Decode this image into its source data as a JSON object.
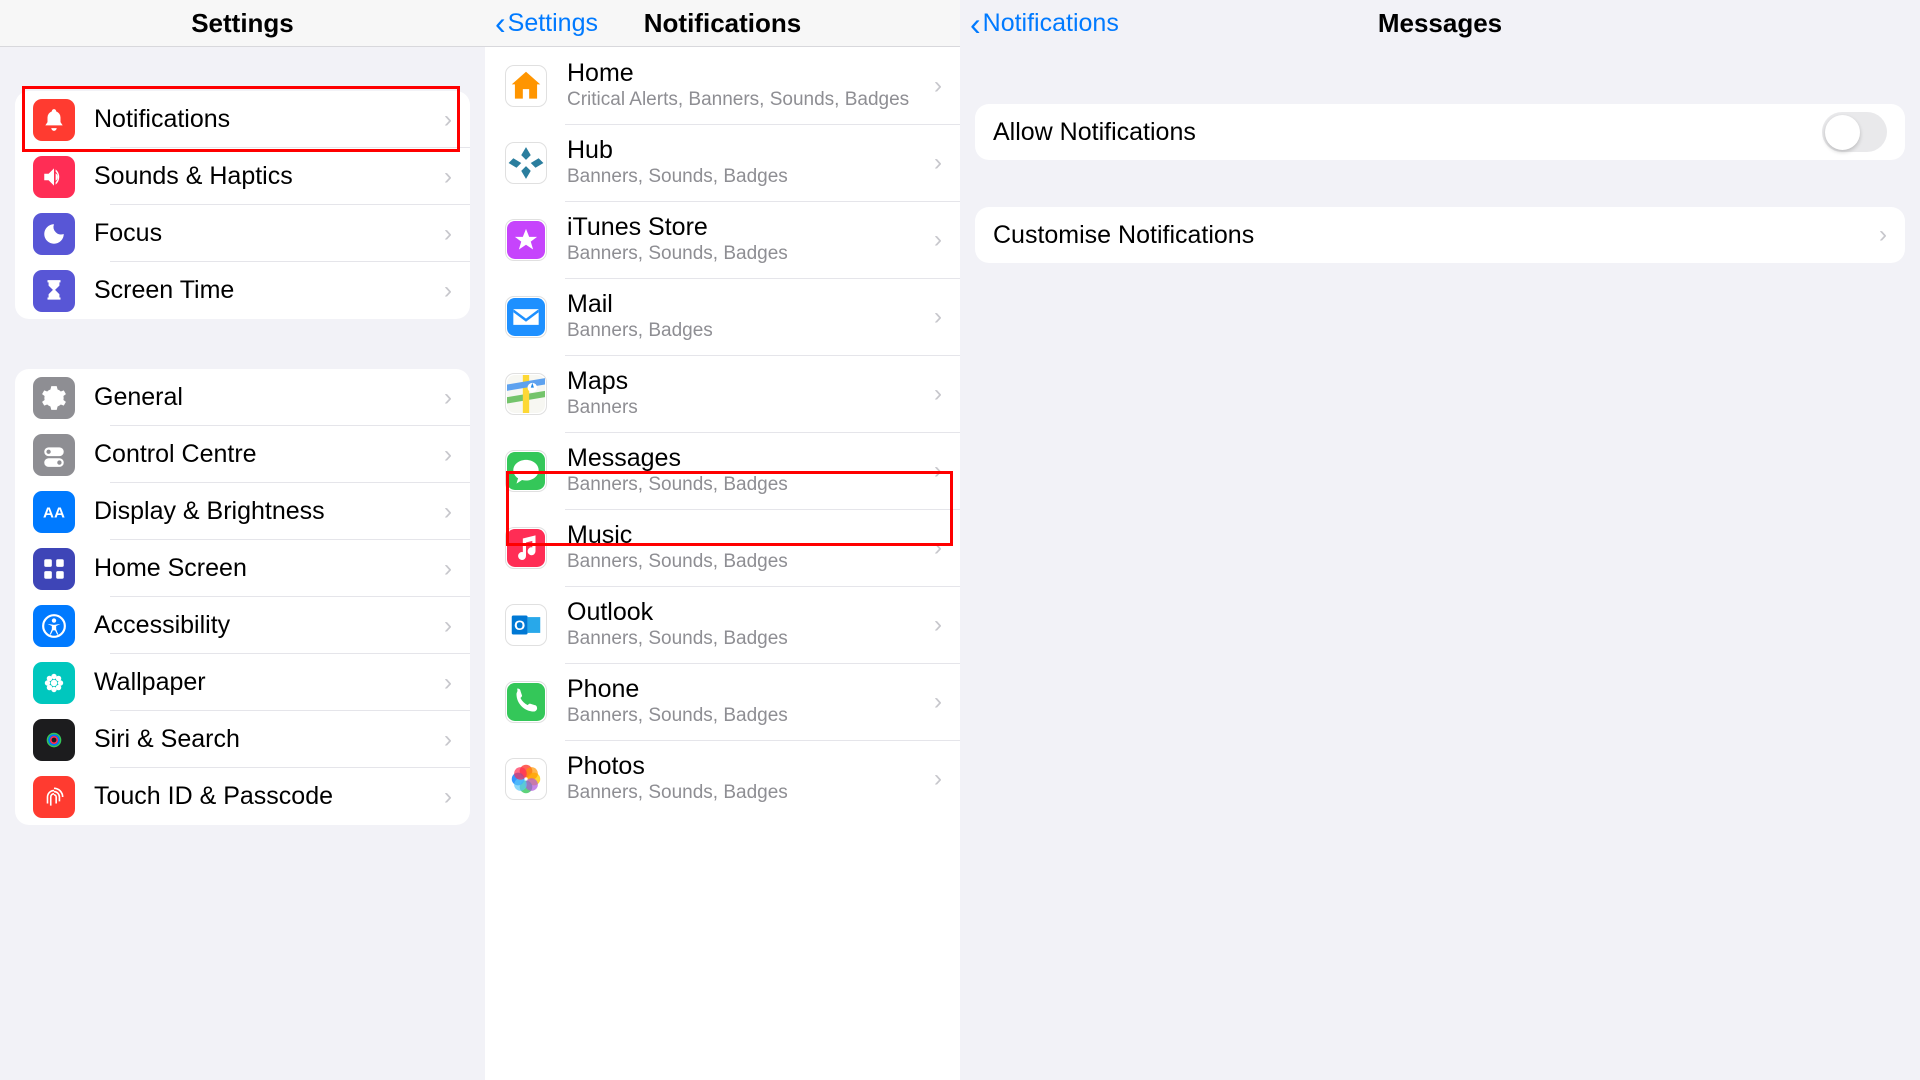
{
  "pane1": {
    "title": "Settings",
    "group1": [
      {
        "label": "Notifications",
        "icon": "bell",
        "color": "#ff3b30"
      },
      {
        "label": "Sounds & Haptics",
        "icon": "speaker",
        "color": "#ff2d55"
      },
      {
        "label": "Focus",
        "icon": "moon",
        "color": "#5856d6"
      },
      {
        "label": "Screen Time",
        "icon": "hourglass",
        "color": "#5856d6"
      }
    ],
    "group2": [
      {
        "label": "General",
        "icon": "gear",
        "color": "#8e8e93"
      },
      {
        "label": "Control Centre",
        "icon": "switches",
        "color": "#8e8e93"
      },
      {
        "label": "Display & Brightness",
        "icon": "aa",
        "color": "#007aff"
      },
      {
        "label": "Home Screen",
        "icon": "grid4",
        "color": "#3e45b7"
      },
      {
        "label": "Accessibility",
        "icon": "accessibility",
        "color": "#007aff"
      },
      {
        "label": "Wallpaper",
        "icon": "flower",
        "color": "#00c7be"
      },
      {
        "label": "Siri & Search",
        "icon": "siri",
        "color": "#1c1c1e"
      },
      {
        "label": "Touch ID & Passcode",
        "icon": "fingerprint",
        "color": "#ff3b30"
      }
    ]
  },
  "pane2": {
    "back": "Settings",
    "title": "Notifications",
    "apps": [
      {
        "label": "Home",
        "sub": "Critical Alerts, Banners, Sounds, Badges",
        "icon": "home"
      },
      {
        "label": "Hub",
        "sub": "Banners, Sounds, Badges",
        "icon": "hub"
      },
      {
        "label": "iTunes Store",
        "sub": "Banners, Sounds, Badges",
        "icon": "star"
      },
      {
        "label": "Mail",
        "sub": "Banners, Badges",
        "icon": "mail"
      },
      {
        "label": "Maps",
        "sub": "Banners",
        "icon": "maps"
      },
      {
        "label": "Messages",
        "sub": "Banners, Sounds, Badges",
        "icon": "messages"
      },
      {
        "label": "Music",
        "sub": "Banners, Sounds, Badges",
        "icon": "music"
      },
      {
        "label": "Outlook",
        "sub": "Banners, Sounds, Badges",
        "icon": "outlook"
      },
      {
        "label": "Phone",
        "sub": "Banners, Sounds, Badges",
        "icon": "phone"
      },
      {
        "label": "Photos",
        "sub": "Banners, Sounds, Badges",
        "icon": "photos"
      }
    ]
  },
  "pane3": {
    "back": "Notifications",
    "title": "Messages",
    "allow_label": "Allow Notifications",
    "allow_value": false,
    "customise_label": "Customise Notifications"
  }
}
